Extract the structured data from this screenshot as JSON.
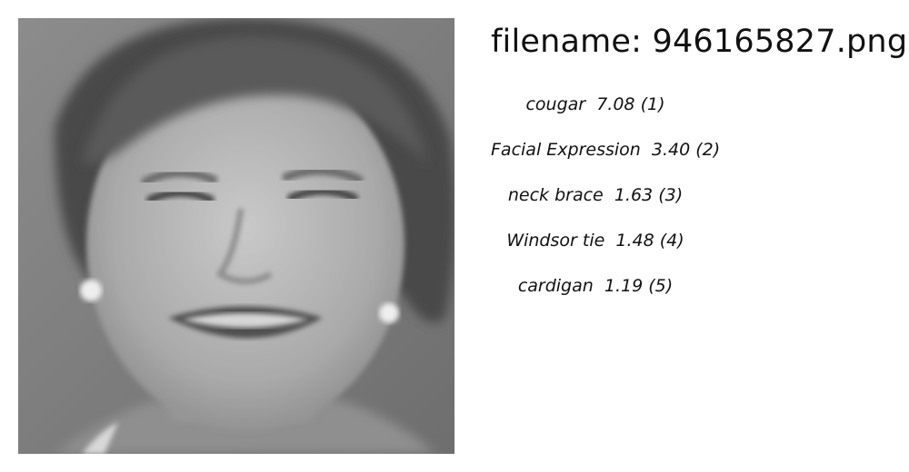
{
  "header": {
    "title": "filename: 946165827.png"
  },
  "image": {
    "icon": "grayscale-face-photo"
  },
  "predictions": [
    {
      "label": "cougar",
      "score": "7.08",
      "rank": "(1)"
    },
    {
      "label": "Facial Expression",
      "score": "3.40",
      "rank": "(2)"
    },
    {
      "label": "neck brace",
      "score": "1.63",
      "rank": "(3)"
    },
    {
      "label": "Windsor tie",
      "score": "1.48",
      "rank": "(4)"
    },
    {
      "label": "cardigan",
      "score": "1.19",
      "rank": "(5)"
    }
  ]
}
